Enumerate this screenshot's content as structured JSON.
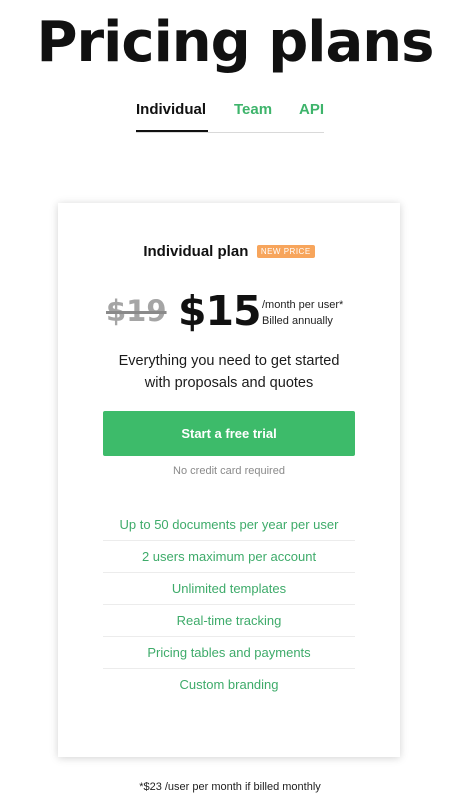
{
  "page": {
    "title": "Pricing plans"
  },
  "tabs": [
    {
      "label": "Individual",
      "active": true
    },
    {
      "label": "Team",
      "active": false
    },
    {
      "label": "API",
      "active": false
    }
  ],
  "plan": {
    "name": "Individual plan",
    "badge": "NEW PRICE",
    "old_price": "$19",
    "price": "$15",
    "price_unit": "/month per user*",
    "billing": "Billed annually",
    "description_line1": "Everything you need to get started",
    "description_line2": "with proposals and quotes",
    "cta_label": "Start a free trial",
    "cta_note": "No credit card required",
    "features": [
      "Up to 50 documents per year per user",
      "2 users maximum per account",
      "Unlimited templates",
      "Real-time tracking",
      "Pricing tables and payments",
      "Custom branding"
    ]
  },
  "footnote": "*$23 /user per month if billed monthly",
  "colors": {
    "accent_green": "#3dbb6a",
    "badge_orange": "#f7a55c",
    "text_dark": "#111111"
  }
}
